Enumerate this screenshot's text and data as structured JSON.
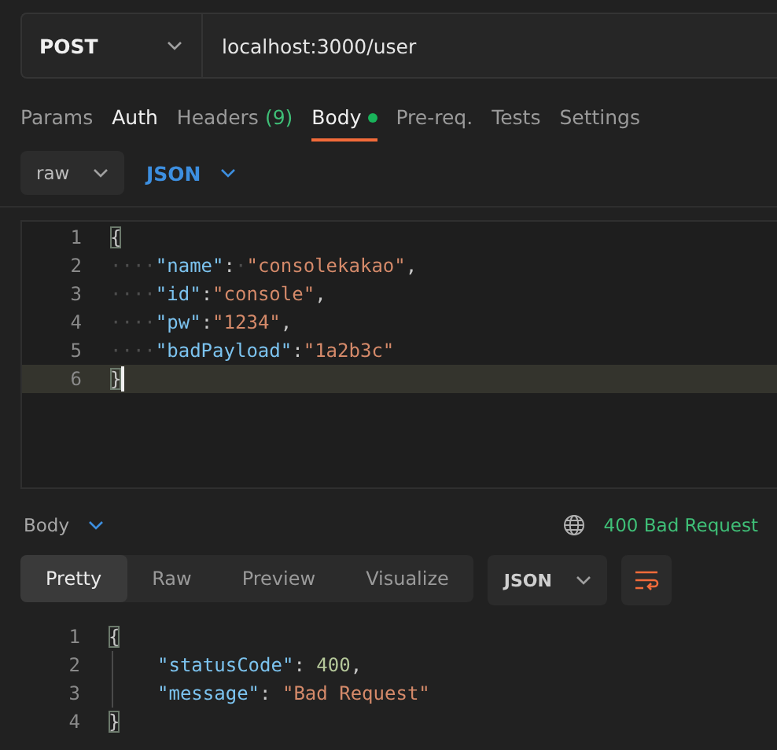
{
  "request": {
    "method": "POST",
    "url": "localhost:3000/user"
  },
  "tabs": [
    {
      "label": "Params",
      "selected": false,
      "configured": false
    },
    {
      "label": "Auth",
      "selected": false,
      "configured": true
    },
    {
      "label": "Headers",
      "count": "(9)",
      "selected": false,
      "configured": false
    },
    {
      "label": "Body",
      "selected": true,
      "configured": true,
      "dirty": true
    },
    {
      "label": "Pre-req.",
      "selected": false,
      "configured": false
    },
    {
      "label": "Tests",
      "selected": false,
      "configured": false
    },
    {
      "label": "Settings",
      "selected": false,
      "configured": false
    }
  ],
  "body_mode": "raw",
  "body_language": "JSON",
  "editor": {
    "lines": [
      {
        "number": "1",
        "current": false,
        "tokens": [
          {
            "kind": "brace",
            "text": "{",
            "matched": true
          }
        ]
      },
      {
        "number": "2",
        "current": false,
        "tokens": [
          {
            "kind": "space",
            "text": "····"
          },
          {
            "kind": "key",
            "text": "\"name\""
          },
          {
            "kind": "punct",
            "text": ":"
          },
          {
            "kind": "space",
            "text": "·"
          },
          {
            "kind": "string",
            "text": "\"consolekakao\""
          },
          {
            "kind": "punct",
            "text": ","
          }
        ]
      },
      {
        "number": "3",
        "current": false,
        "tokens": [
          {
            "kind": "space",
            "text": "····"
          },
          {
            "kind": "key",
            "text": "\"id\""
          },
          {
            "kind": "punct",
            "text": ":"
          },
          {
            "kind": "string",
            "text": "\"console\""
          },
          {
            "kind": "punct",
            "text": ","
          }
        ]
      },
      {
        "number": "4",
        "current": false,
        "tokens": [
          {
            "kind": "space",
            "text": "····"
          },
          {
            "kind": "key",
            "text": "\"pw\""
          },
          {
            "kind": "punct",
            "text": ":"
          },
          {
            "kind": "string",
            "text": "\"1234\""
          },
          {
            "kind": "punct",
            "text": ","
          }
        ]
      },
      {
        "number": "5",
        "current": false,
        "tokens": [
          {
            "kind": "space",
            "text": "····"
          },
          {
            "kind": "key",
            "text": "\"badPayload\""
          },
          {
            "kind": "punct",
            "text": ":"
          },
          {
            "kind": "string",
            "text": "\"1a2b3c\""
          }
        ]
      },
      {
        "number": "6",
        "current": true,
        "tokens": [
          {
            "kind": "brace",
            "text": "}",
            "matched": true
          }
        ]
      }
    ]
  },
  "response": {
    "label": "Body",
    "status": "400 Bad Request",
    "view_tabs": [
      {
        "label": "Pretty",
        "selected": true
      },
      {
        "label": "Raw",
        "selected": false
      },
      {
        "label": "Preview",
        "selected": false
      },
      {
        "label": "Visualize",
        "selected": false
      }
    ],
    "format": "JSON",
    "lines": [
      {
        "number": "1",
        "tokens": [
          {
            "kind": "brace",
            "text": "{",
            "matched": true
          }
        ]
      },
      {
        "number": "2",
        "kind": "member",
        "tokens": [
          {
            "kind": "key",
            "text": "\"statusCode\""
          },
          {
            "kind": "punct",
            "text": ": "
          },
          {
            "kind": "number",
            "text": "400"
          },
          {
            "kind": "punct",
            "text": ","
          }
        ]
      },
      {
        "number": "3",
        "kind": "member",
        "tokens": [
          {
            "kind": "key",
            "text": "\"message\""
          },
          {
            "kind": "punct",
            "text": ": "
          },
          {
            "kind": "string",
            "text": "\"Bad Request\""
          }
        ]
      },
      {
        "number": "4",
        "tokens": [
          {
            "kind": "brace",
            "text": "}",
            "matched": true
          }
        ]
      }
    ]
  }
}
